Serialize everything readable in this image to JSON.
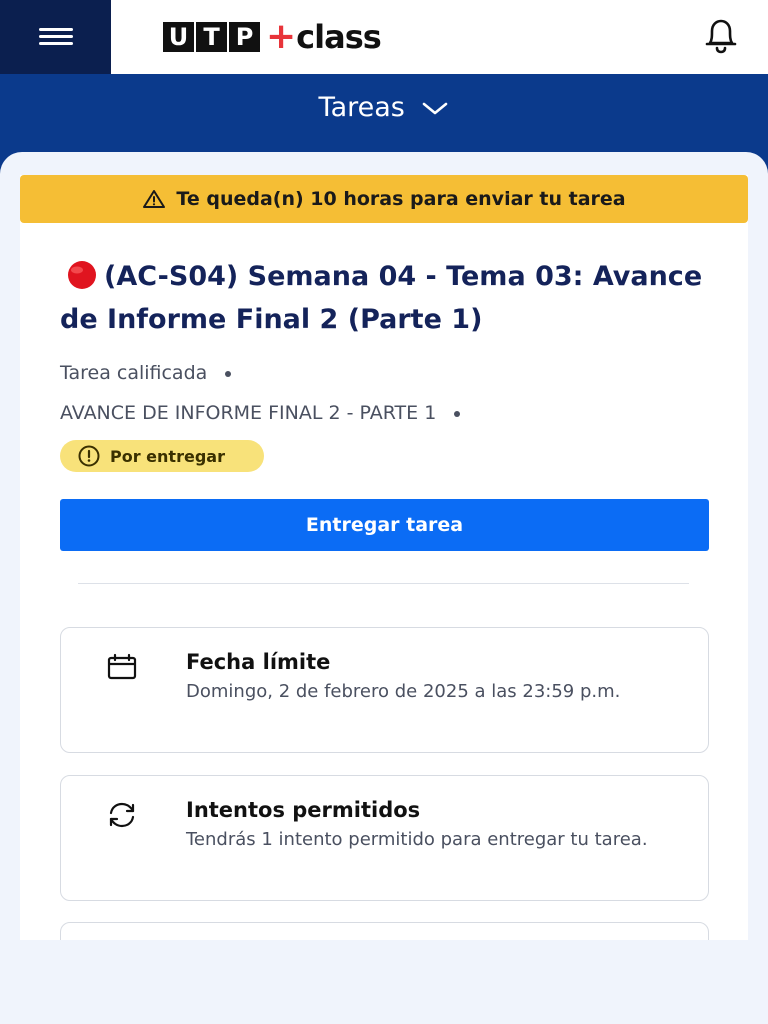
{
  "header": {
    "menu_icon": "hamburger-menu-icon",
    "logo_box_letters": [
      "U",
      "T",
      "P"
    ],
    "logo_plus": "+",
    "logo_class": "class",
    "bell_icon": "bell-icon"
  },
  "section": {
    "title": "Tareas",
    "chevron_icon": "chevron-down-icon"
  },
  "alert": {
    "icon": "warning-triangle-icon",
    "text": "Te queda(n) 10 horas para enviar tu tarea",
    "color": "#f5be35"
  },
  "task": {
    "status_dot_icon": "red-circle-icon",
    "title": "(AC-S04) Semana 04 - Tema 03: Avance de Informe Final 2 (Parte 1)",
    "type": "Tarea calificada",
    "name": "AVANCE DE INFORME FINAL 2 - PARTE 1",
    "badge": {
      "icon": "exclamation-circle-icon",
      "label": "Por entregar",
      "color": "#f8e27a"
    },
    "submit_label": "Entregar tarea",
    "submit_color": "#0b6cf5"
  },
  "info_cards": [
    {
      "icon": "calendar-icon",
      "title": "Fecha límite",
      "detail": "Domingo, 2 de febrero de 2025 a las 23:59 p.m."
    },
    {
      "icon": "refresh-icon",
      "title": "Intentos permitidos",
      "detail": "Tendrás 1 intento permitido para entregar tu tarea."
    }
  ]
}
